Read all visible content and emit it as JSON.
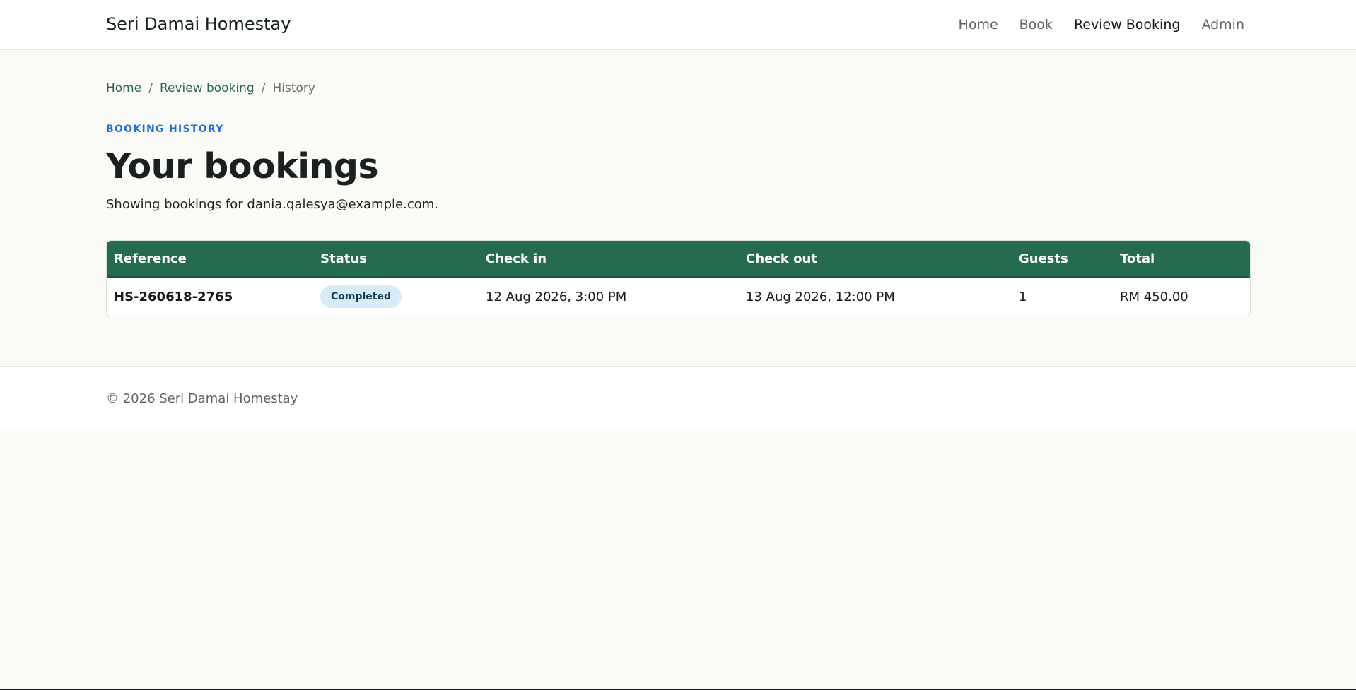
{
  "navbar": {
    "brand": "Seri Damai Homestay",
    "links": [
      {
        "label": "Home"
      },
      {
        "label": "Book"
      },
      {
        "label": "Review Booking"
      },
      {
        "label": "Admin"
      }
    ]
  },
  "breadcrumb": {
    "items": [
      "Home",
      "Review booking",
      "History"
    ],
    "separator": "/"
  },
  "header": {
    "eyebrow": "BOOKING HISTORY",
    "title": "Your bookings",
    "subtitle": "Showing bookings for dania.qalesya@example.com."
  },
  "table": {
    "columns": [
      "Reference",
      "Status",
      "Check in",
      "Check out",
      "Guests",
      "Total"
    ],
    "rows": [
      {
        "reference": "HS-260618-2765",
        "status": "Completed",
        "check_in": "12 Aug 2026, 3:00 PM",
        "check_out": "13 Aug 2026, 12:00 PM",
        "guests": "1",
        "total": "RM 450.00"
      }
    ]
  },
  "footer": {
    "text": "© 2026 Seri Damai Homestay"
  },
  "colors": {
    "accent_green": "#256b4f",
    "eyebrow_blue": "#1f6fe0",
    "badge_bg": "#d7ebf8",
    "page_bg": "#fafaf6"
  }
}
